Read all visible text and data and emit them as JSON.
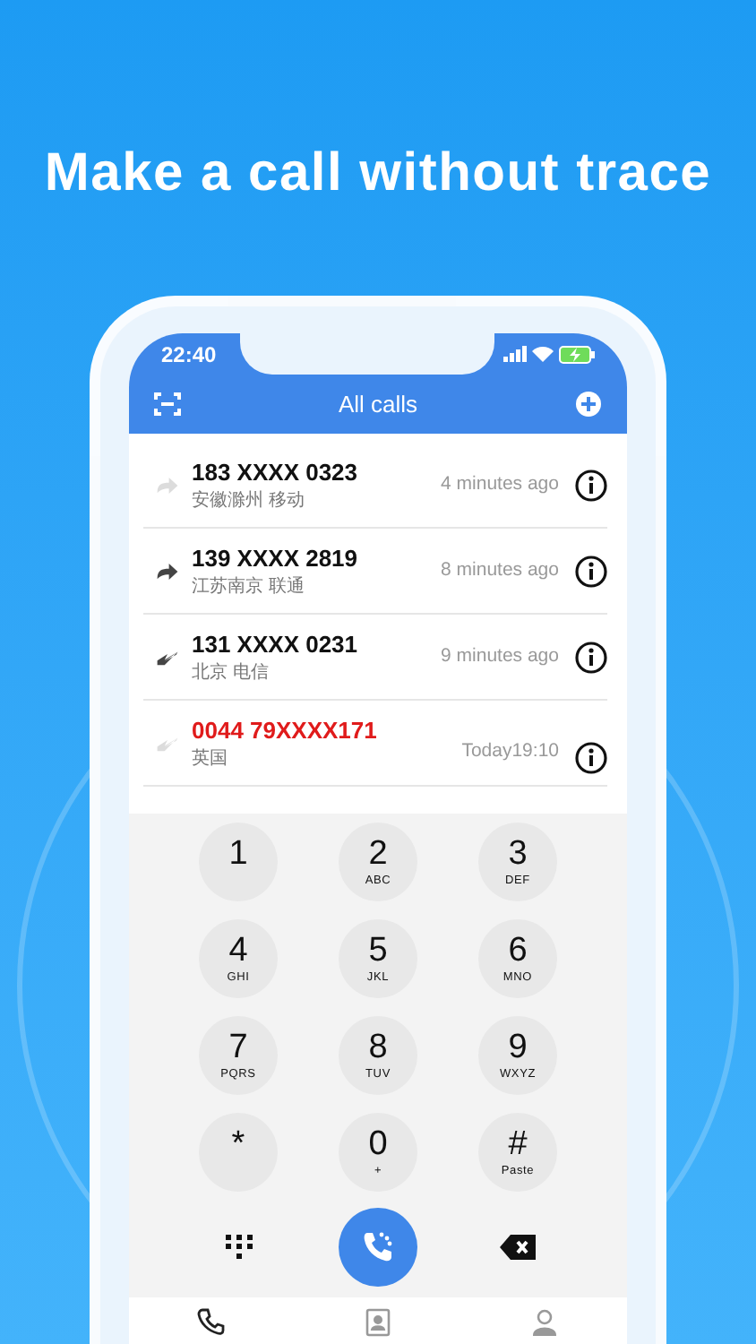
{
  "headline": "Make a call without trace",
  "status_bar": {
    "time": "22:40"
  },
  "header": {
    "title": "All calls"
  },
  "calls": [
    {
      "number": "183 XXXX 0323",
      "location": "安徽滁州 移动",
      "time": "4 minutes ago",
      "kind": "outgoing",
      "faded": true,
      "missed": false
    },
    {
      "number": "139 XXXX 2819",
      "location": "江苏南京 联通",
      "time": "8 minutes ago",
      "kind": "outgoing",
      "faded": false,
      "missed": false
    },
    {
      "number": "131 XXXX 0231",
      "location": "北京 电信",
      "time": "9 minutes ago",
      "kind": "incoming",
      "faded": false,
      "missed": false
    },
    {
      "number": "0044 79XXXX171",
      "location": "英国",
      "time": "Today19:10",
      "kind": "incoming",
      "faded": true,
      "missed": true
    }
  ],
  "keypad": [
    {
      "digit": "1"
    },
    {
      "digit": "2",
      "letters": "ABC"
    },
    {
      "digit": "3",
      "letters": "DEF"
    },
    {
      "digit": "4",
      "letters": "GHI"
    },
    {
      "digit": "5",
      "letters": "JKL"
    },
    {
      "digit": "6",
      "letters": "MNO"
    },
    {
      "digit": "7",
      "letters": "PQRS"
    },
    {
      "digit": "8",
      "letters": "TUV"
    },
    {
      "digit": "9",
      "letters": "WXYZ"
    },
    {
      "digit": "*"
    },
    {
      "digit": "0",
      "letters": "+"
    },
    {
      "digit": "#",
      "letters": "Paste"
    }
  ],
  "tab_bar": [
    {
      "kind": "calls",
      "selected": true
    },
    {
      "kind": "contacts",
      "selected": false
    },
    {
      "kind": "me",
      "selected": false
    }
  ]
}
